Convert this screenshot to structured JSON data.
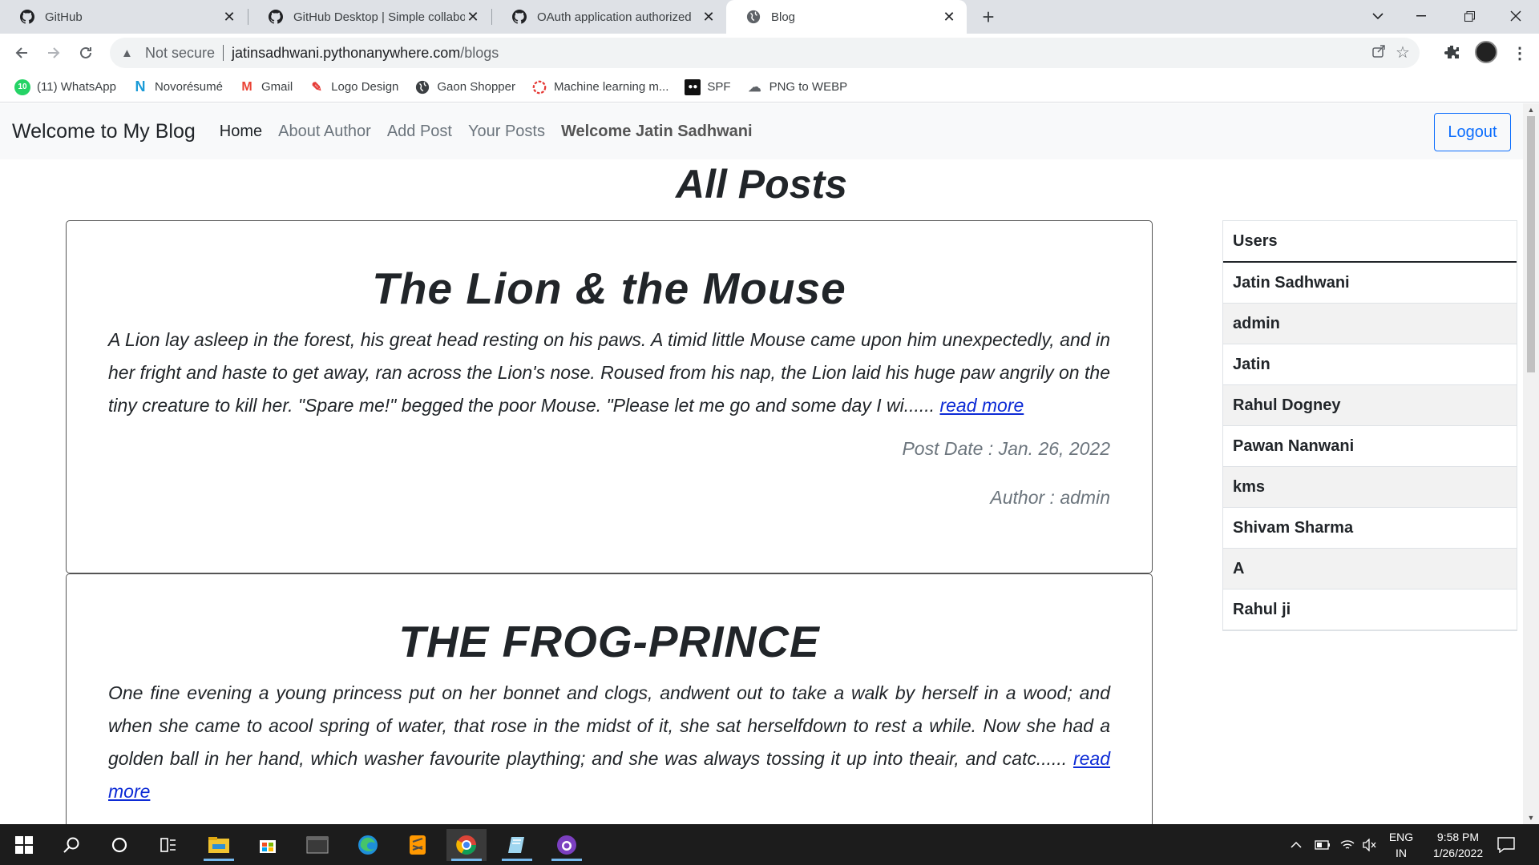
{
  "browser": {
    "tabs": [
      {
        "label": "GitHub",
        "icon": "github-icon"
      },
      {
        "label": "GitHub Desktop | Simple collabo",
        "icon": "github-icon"
      },
      {
        "label": "OAuth application authorized",
        "icon": "github-icon"
      },
      {
        "label": "Blog",
        "icon": "globe-icon",
        "active": true
      }
    ],
    "omnibox": {
      "security": "Not secure",
      "url_host": "jatinsadhwani.pythonanywhere.com",
      "url_path": "/blogs"
    },
    "bookmarks": [
      {
        "label": "(11) WhatsApp",
        "badge": "10"
      },
      {
        "label": "Novorésumé"
      },
      {
        "label": "Gmail"
      },
      {
        "label": "Logo Design"
      },
      {
        "label": "Gaon Shopper"
      },
      {
        "label": "Machine learning m..."
      },
      {
        "label": "SPF"
      },
      {
        "label": "PNG to WEBP"
      }
    ]
  },
  "navbar": {
    "brand": "Welcome to My Blog",
    "links": [
      "Home",
      "About Author",
      "Add Post",
      "Your Posts"
    ],
    "welcome": "Welcome Jatin Sadhwani",
    "logout": "Logout"
  },
  "page": {
    "heading": "All Posts"
  },
  "posts": [
    {
      "title": "The Lion & the Mouse",
      "excerpt": "A Lion lay asleep in the forest, his great head resting on his paws. A timid little Mouse came upon him unexpectedly, and in her fright and haste to get away, ran across the Lion's nose. Roused from his nap, the Lion laid his huge paw angrily on the tiny creature to kill her. \"Spare me!\" begged the poor Mouse. \"Please let me go and some day I wi......",
      "read_more": "read more",
      "date": "Post Date : Jan. 26, 2022",
      "author": "Author : admin"
    },
    {
      "title": "THE FROG-PRINCE",
      "excerpt": "One fine evening a young princess put on her bonnet and clogs, andwent out to take a walk by herself in a wood; and when she came to acool spring of water, that rose in the midst of it, she sat herselfdown to rest a while. Now she had a golden ball in her hand, which washer favourite plaything; and she was always tossing it up into theair, and catc......",
      "read_more": "read more"
    }
  ],
  "users": {
    "header": "Users",
    "list": [
      "Jatin Sadhwani",
      "admin",
      "Jatin",
      "Rahul Dogney",
      "Pawan Nanwani",
      "kms",
      "Shivam Sharma",
      "A",
      "Rahul ji"
    ]
  },
  "taskbar": {
    "lang_top": "ENG",
    "lang_bottom": "IN",
    "time": "9:58 PM",
    "date": "1/26/2022"
  },
  "colors": {
    "link": "#0d2bd6",
    "logout": "#0d6efd",
    "navbar_bg": "#f8f9fa"
  }
}
